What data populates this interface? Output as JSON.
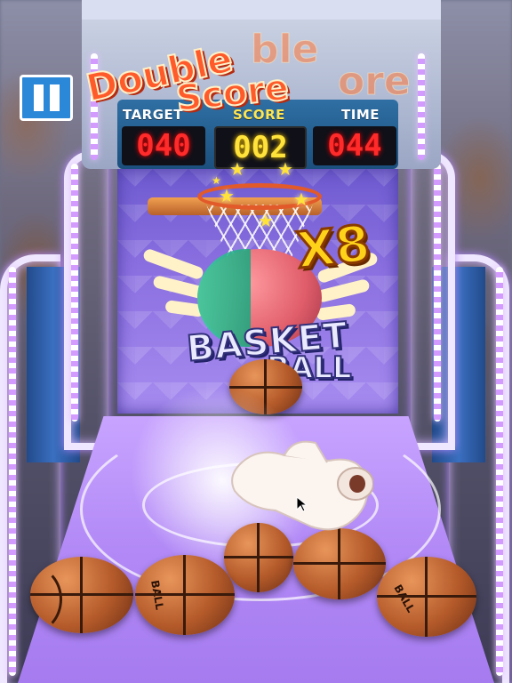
{
  "hud": {
    "target_label": "TARGET",
    "score_label": "SCORE",
    "time_label": "TIME",
    "target_value": "040",
    "score_value": "002",
    "time_value": "044"
  },
  "controls": {
    "pause_icon": "pause-icon"
  },
  "banner": {
    "line1": "Double",
    "line2": "Score",
    "ghost_line1": "ble",
    "ghost_line2": "ore"
  },
  "multiplier": "X8",
  "logo": {
    "line1": "BASKET",
    "line2": "BALL"
  },
  "balls": {
    "label": "BALL"
  },
  "colors": {
    "pause_button": "#2b87d8",
    "digit_red": "#ff2a2a",
    "digit_yellow": "#ffe23a",
    "multiplier": "#ffd21a",
    "banner": "#ff5a2a"
  }
}
